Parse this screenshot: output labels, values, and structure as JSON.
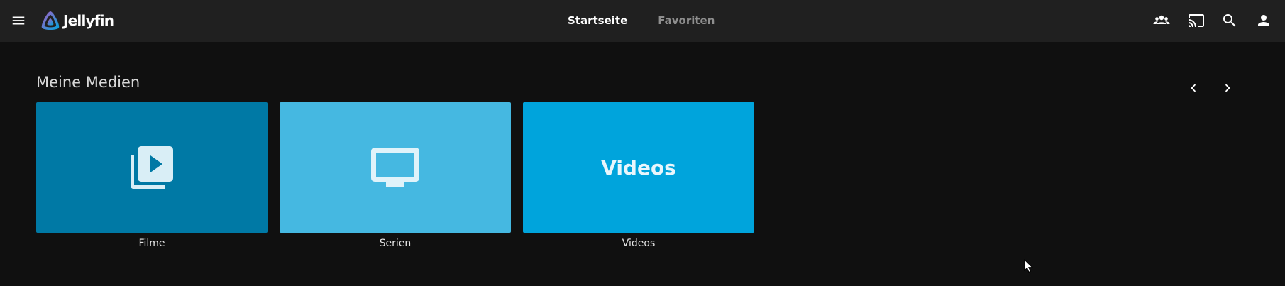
{
  "app": {
    "name": "Jellyfin"
  },
  "nav": {
    "tabs": [
      {
        "label": "Startseite",
        "active": true
      },
      {
        "label": "Favoriten",
        "active": false
      }
    ]
  },
  "header_icons": {
    "menu": "menu-icon",
    "users": "users-icon",
    "cast": "cast-icon",
    "search": "search-icon",
    "user": "user-icon"
  },
  "section": {
    "title": "Meine Medien"
  },
  "libraries": [
    {
      "label": "Filme",
      "icon": "video-library-icon",
      "color": "#0079a5"
    },
    {
      "label": "Serien",
      "icon": "tv-icon",
      "color": "#45b8e1"
    },
    {
      "label": "Videos",
      "tile_text": "Videos",
      "color": "#00a4dc"
    }
  ],
  "colors": {
    "header_bg": "#202020",
    "page_bg": "#101010",
    "logo_gradient_start": "#aa5cc3",
    "logo_gradient_end": "#00a4dc"
  }
}
